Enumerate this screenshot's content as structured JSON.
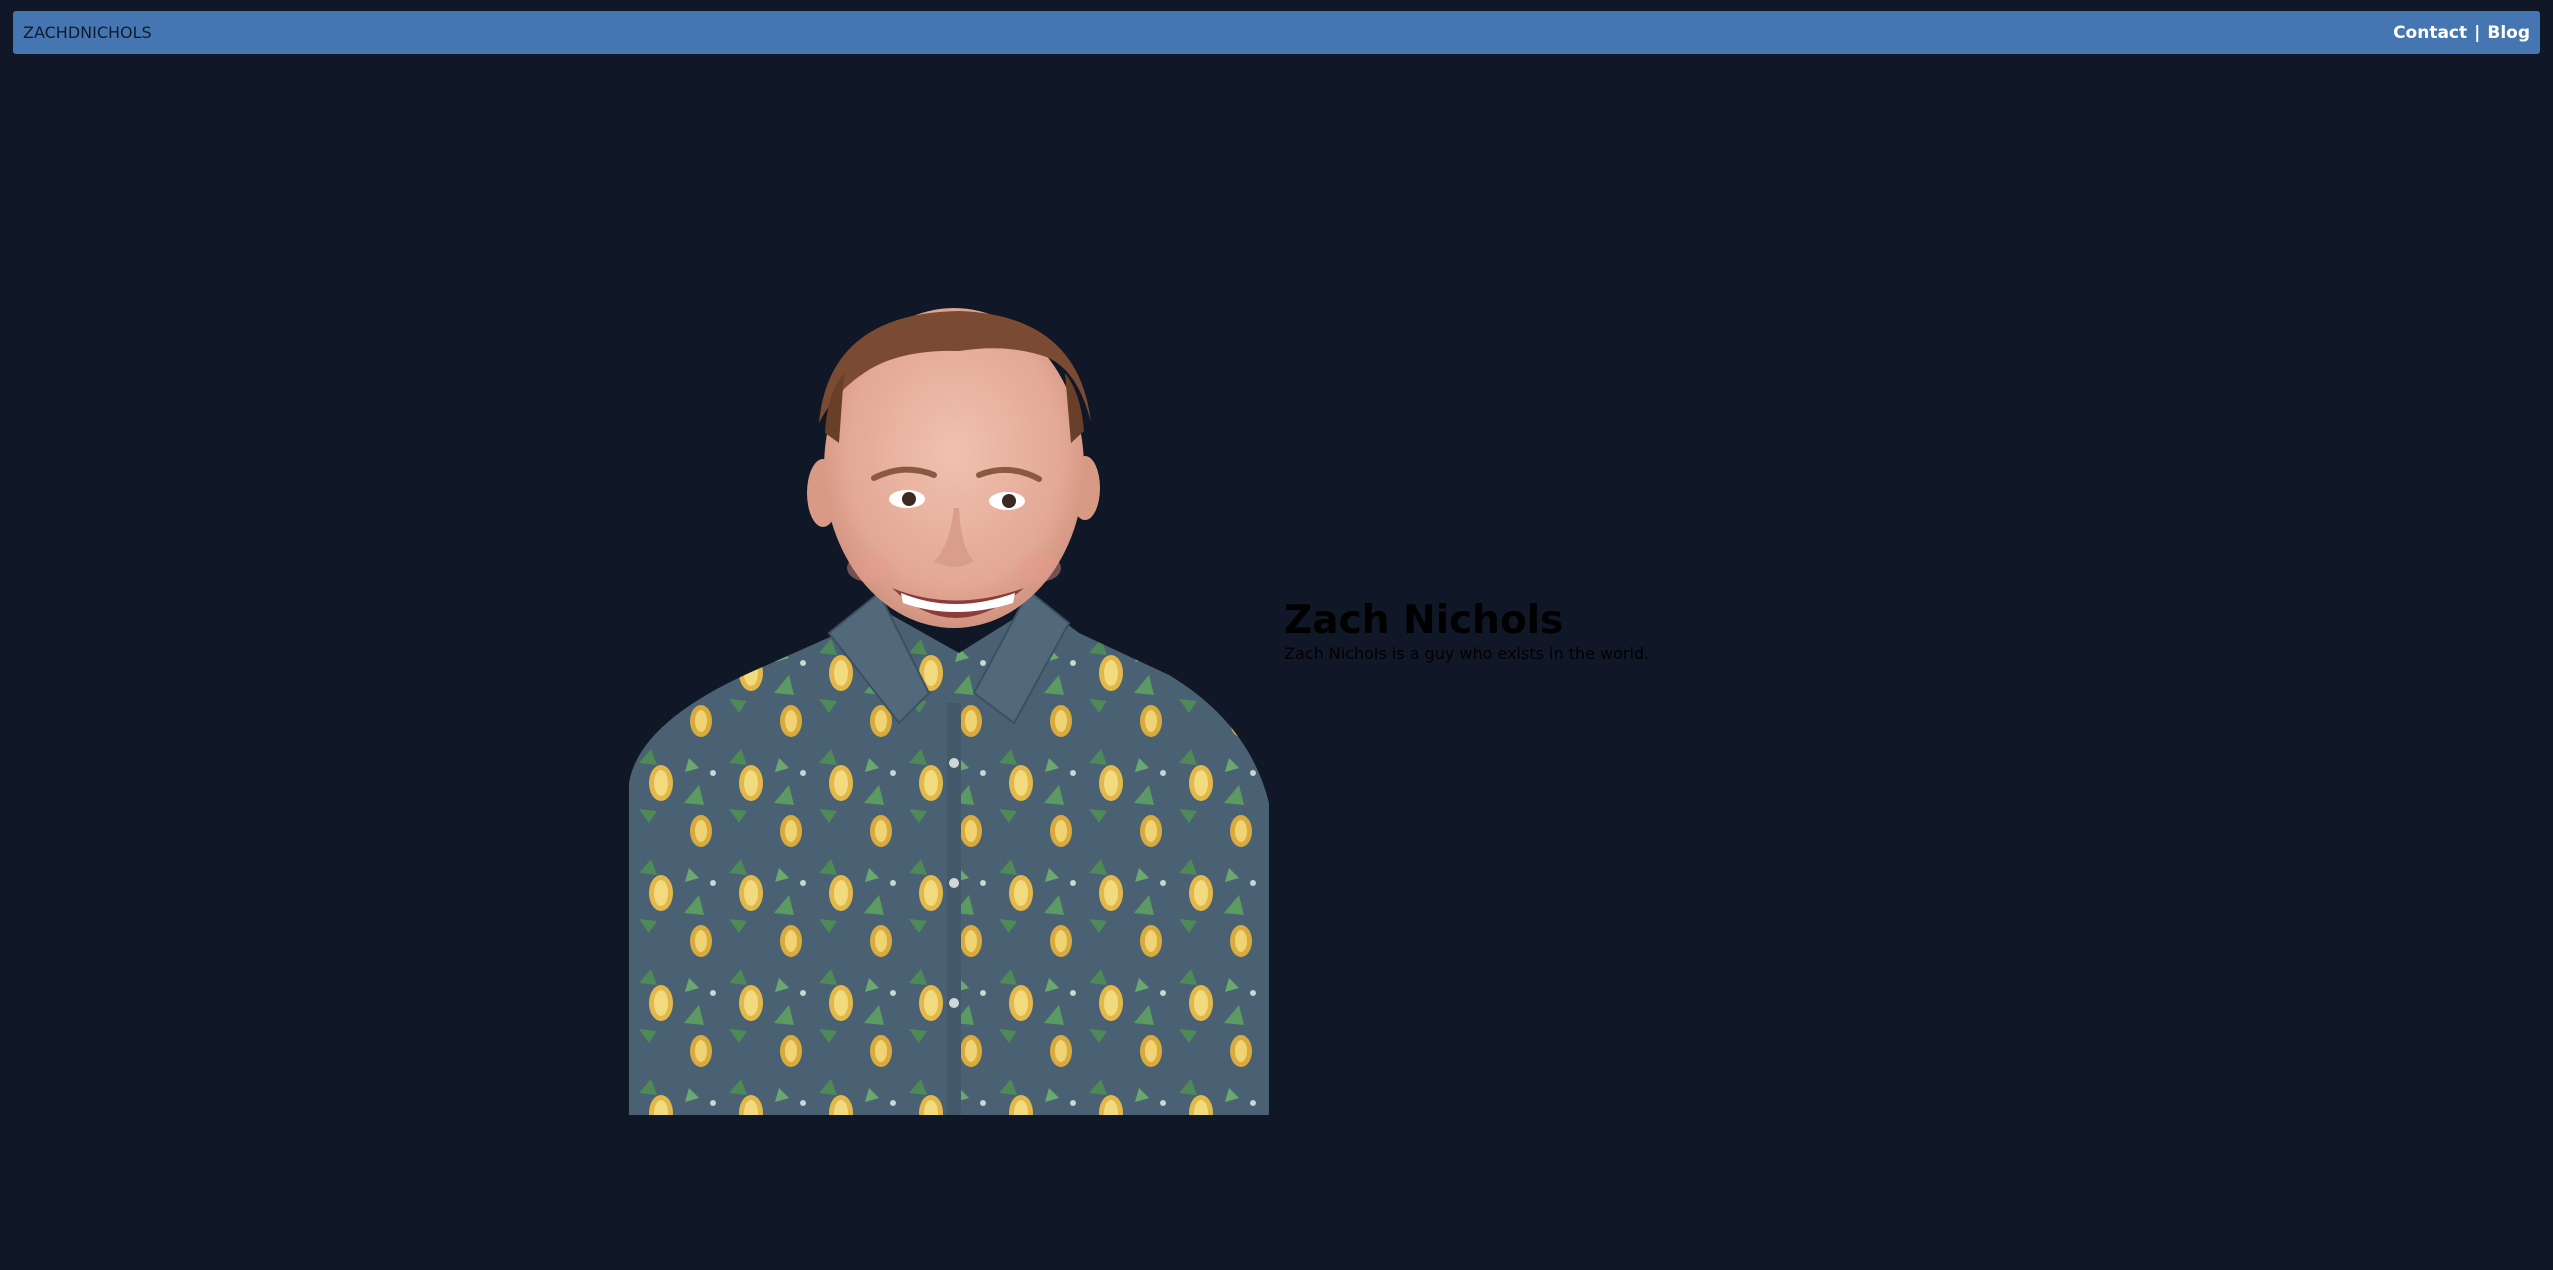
{
  "navbar": {
    "brand": "ZACHDNICHOLS",
    "links": [
      {
        "label": "Contact"
      },
      {
        "label": "Blog"
      }
    ],
    "separator": "|",
    "background_color": "#4676b2"
  },
  "hero": {
    "title": "Zach Nichols",
    "tagline": "Zach Nichols is a guy who exists in the world."
  },
  "colors": {
    "page_background": "#101727",
    "text": "#000000",
    "nav_link_text": "#ffffff"
  }
}
